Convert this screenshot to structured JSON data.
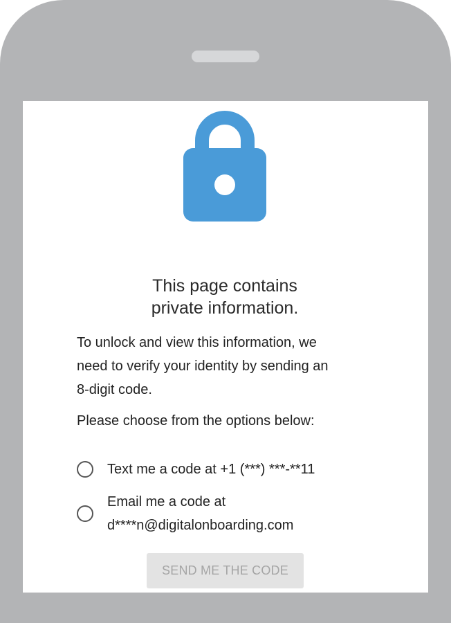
{
  "header": {
    "title_line1": "This page contains",
    "title_line2": "private information."
  },
  "icons": {
    "lock": "lock-icon",
    "color": "#4a9bd8"
  },
  "body": {
    "intro_line1": "To unlock and view this information, we",
    "intro_line2": "need to verify your identity by sending an",
    "intro_line3": "8-digit code.",
    "prompt": "Please choose from the options below:"
  },
  "options": [
    {
      "line1": "Text me a code at +1 (***) ***-**11",
      "selected": false
    },
    {
      "line1": "Email me a code at",
      "line2": "d****n@digitalonboarding.com",
      "selected": false
    }
  ],
  "actions": {
    "send_label": "SEND ME THE CODE",
    "send_enabled": false
  }
}
